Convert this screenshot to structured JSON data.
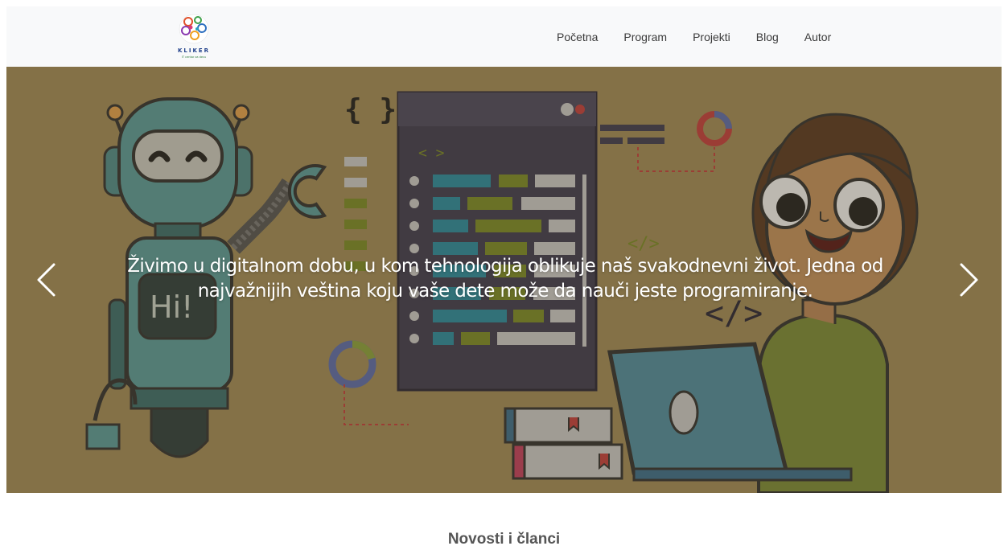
{
  "brand": {
    "name": "KLIKER",
    "tagline": "IT centar za decu"
  },
  "nav": {
    "items": [
      {
        "label": "Početna"
      },
      {
        "label": "Program"
      },
      {
        "label": "Projekti"
      },
      {
        "label": "Blog"
      },
      {
        "label": "Autor"
      }
    ]
  },
  "hero": {
    "caption": "Živimo u digitalnom dobu, u kom tehnologija oblikuje naš svakodnevni život. Jedna od najvažnijih veština koju vaše dete može da nauči jeste programiranje.",
    "robot_screen_text": "Hi!",
    "code_brackets": "{ }",
    "code_tag_small": "< >",
    "code_tag_close": "</>",
    "code_tag_laptop": "</>",
    "prev_icon": "chevron-left-icon",
    "next_icon": "chevron-right-icon"
  },
  "section": {
    "title": "Novosti i članci"
  },
  "colors": {
    "navbar_bg": "#f8f9fa",
    "hero_bg": "#a08a5a",
    "robot": "#4f8c8c",
    "panel": "#3f3d52",
    "shirt": "#7a8a3a"
  }
}
